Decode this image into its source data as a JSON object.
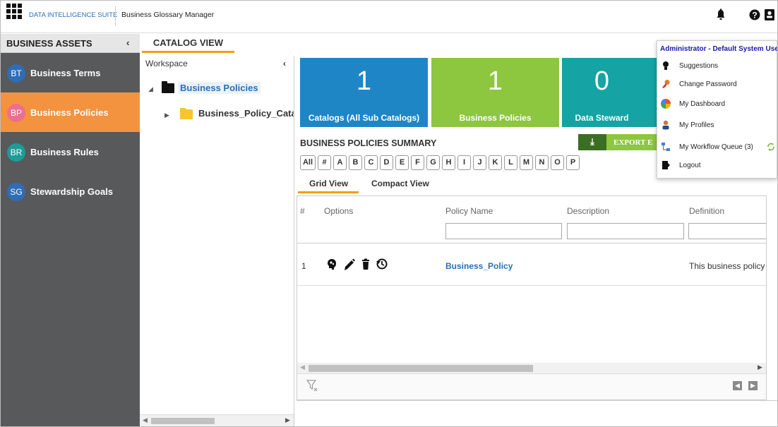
{
  "header": {
    "brand": "DATA INTELLIGENCE SUITE",
    "app_title": "Business Glossary Manager",
    "icons": [
      "apps-grid-icon",
      "bell-icon",
      "help-icon",
      "user-icon"
    ]
  },
  "sidebar": {
    "title": "BUSINESS ASSETS",
    "collapse": "‹",
    "items": [
      {
        "badge": "BT",
        "label": "Business Terms",
        "color": "#2f6db5"
      },
      {
        "badge": "BP",
        "label": "Business Policies",
        "color": "#f3923f"
      },
      {
        "badge": "BR",
        "label": "Business Rules",
        "color": "#1d9c98"
      },
      {
        "badge": "SG",
        "label": "Stewardship Goals",
        "color": "#2f6db5"
      }
    ],
    "active_index": 1
  },
  "tabs": {
    "catalog_view": "CATALOG VIEW"
  },
  "workspace": {
    "title": "Workspace",
    "collapse": "‹",
    "tree": [
      {
        "arrow": "◢",
        "label": "Business Policies",
        "selected": true
      },
      {
        "arrow": "▶",
        "label": "Business_Policy_Catal",
        "selected": false
      }
    ]
  },
  "tiles": [
    {
      "count": "1",
      "caption": "Catalogs (All Sub Catalogs)",
      "color": "#1f86c6"
    },
    {
      "count": "1",
      "caption": "Business Policies",
      "color": "#8dc63f"
    },
    {
      "count": "0",
      "caption": "Data Steward",
      "color": "#15a3a3"
    }
  ],
  "summary": {
    "title": "BUSINESS POLICIES SUMMARY",
    "export_label": "EXPORT E",
    "alphabet": [
      "All",
      "#",
      "A",
      "B",
      "C",
      "D",
      "E",
      "F",
      "G",
      "H",
      "I",
      "J",
      "K",
      "L",
      "M",
      "N",
      "O",
      "P"
    ],
    "view_tabs": [
      "Grid View",
      "Compact View"
    ]
  },
  "grid": {
    "columns": [
      "#",
      "Options",
      "Policy Name",
      "Description",
      "Definition"
    ],
    "rows": [
      {
        "num": "1",
        "policy_name": "Business_Policy",
        "description": "",
        "definition": "This business policy"
      }
    ],
    "option_icons": [
      "brain-icon",
      "pencil-icon",
      "trash-icon",
      "history-icon"
    ],
    "footer_icons": [
      "clear-filter-icon",
      "prev-page-icon",
      "next-page-icon"
    ]
  },
  "user_menu": {
    "header": "Administrator - Default System User",
    "items": [
      {
        "label": "Suggestions",
        "icon": "lightbulb-icon"
      },
      {
        "label": "Change Password",
        "icon": "key-icon"
      },
      {
        "label": "My Dashboard",
        "icon": "dashboard-icon"
      },
      {
        "label": "My Profiles",
        "icon": "profile-icon"
      },
      {
        "label": "My Workflow Queue (3)",
        "icon": "workflow-icon"
      },
      {
        "label": "Logout",
        "icon": "logout-icon"
      }
    ]
  }
}
